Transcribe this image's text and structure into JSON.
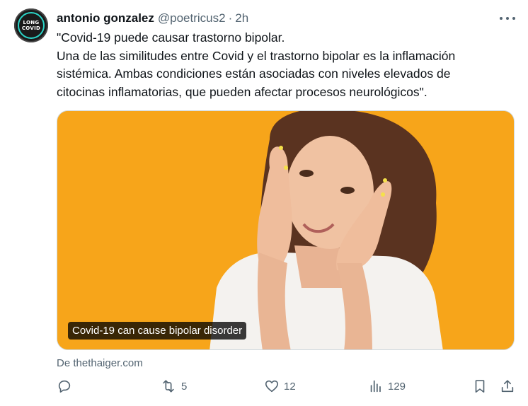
{
  "author": {
    "name": "antonio gonzalez",
    "handle": "@poetricus2",
    "separator": "·",
    "time": "2h",
    "avatar_lines": [
      "LONG",
      "COVID"
    ]
  },
  "text_lines": [
    "\"Covid-19 puede causar trastorno bipolar.",
    "Una de las similitudes entre Covid y el trastorno bipolar es la inflamación",
    "sistémica. Ambas condiciones están asociadas con niveles elevados de",
    "citocinas inflamatorias, que pueden afectar procesos neurológicos\"."
  ],
  "media": {
    "caption": "Covid-19 can cause bipolar disorder",
    "background_color": "#f7a51a"
  },
  "source": "De thethaiger.com",
  "actions": {
    "reply_count": "",
    "retweet_count": "5",
    "like_count": "12",
    "views_count": "129"
  },
  "colors": {
    "text": "#0f1419",
    "secondary": "#536471"
  }
}
